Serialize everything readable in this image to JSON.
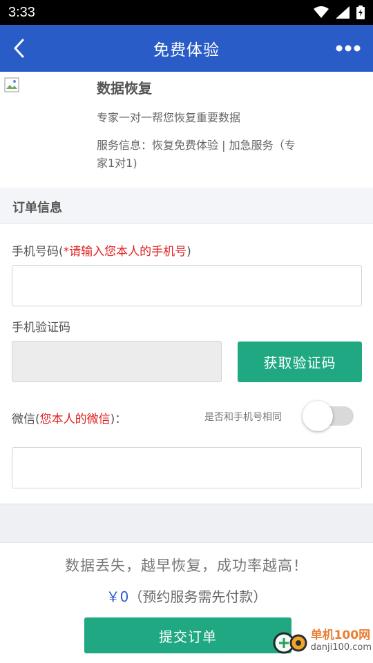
{
  "status": {
    "time": "3:33"
  },
  "appbar": {
    "title": "免费体验"
  },
  "service": {
    "title": "数据恢复",
    "description": "专家一对一帮您恢复重要数据",
    "info": "服务信息：恢复免费体验 | 加急服务（专家1对1)"
  },
  "section": {
    "title": "订单信息"
  },
  "form": {
    "phone_label": "手机号码(",
    "phone_hint": "*请输入您本人的手机号",
    "phone_label_end": ")",
    "phone_value": "",
    "code_label": "手机验证码",
    "code_value": "",
    "code_button": "获取验证码",
    "wechat_label": "微信(",
    "wechat_hint": "您本人的微信",
    "wechat_label_end": ")：",
    "same_as_phone_label": "是否和手机号相同",
    "same_as_phone_on": false,
    "wechat_value": ""
  },
  "bottom": {
    "slogan": "数据丢失，越早恢复，成功率越高！",
    "price_amount": "￥0",
    "price_note": "（预约服务需先付款）",
    "submit_button": "提交订单"
  },
  "watermark": {
    "name": "单机100网",
    "domain": "danji100.com"
  },
  "colors": {
    "primary": "#2a5cc8",
    "accent": "#20a883",
    "warning": "#e02020"
  }
}
